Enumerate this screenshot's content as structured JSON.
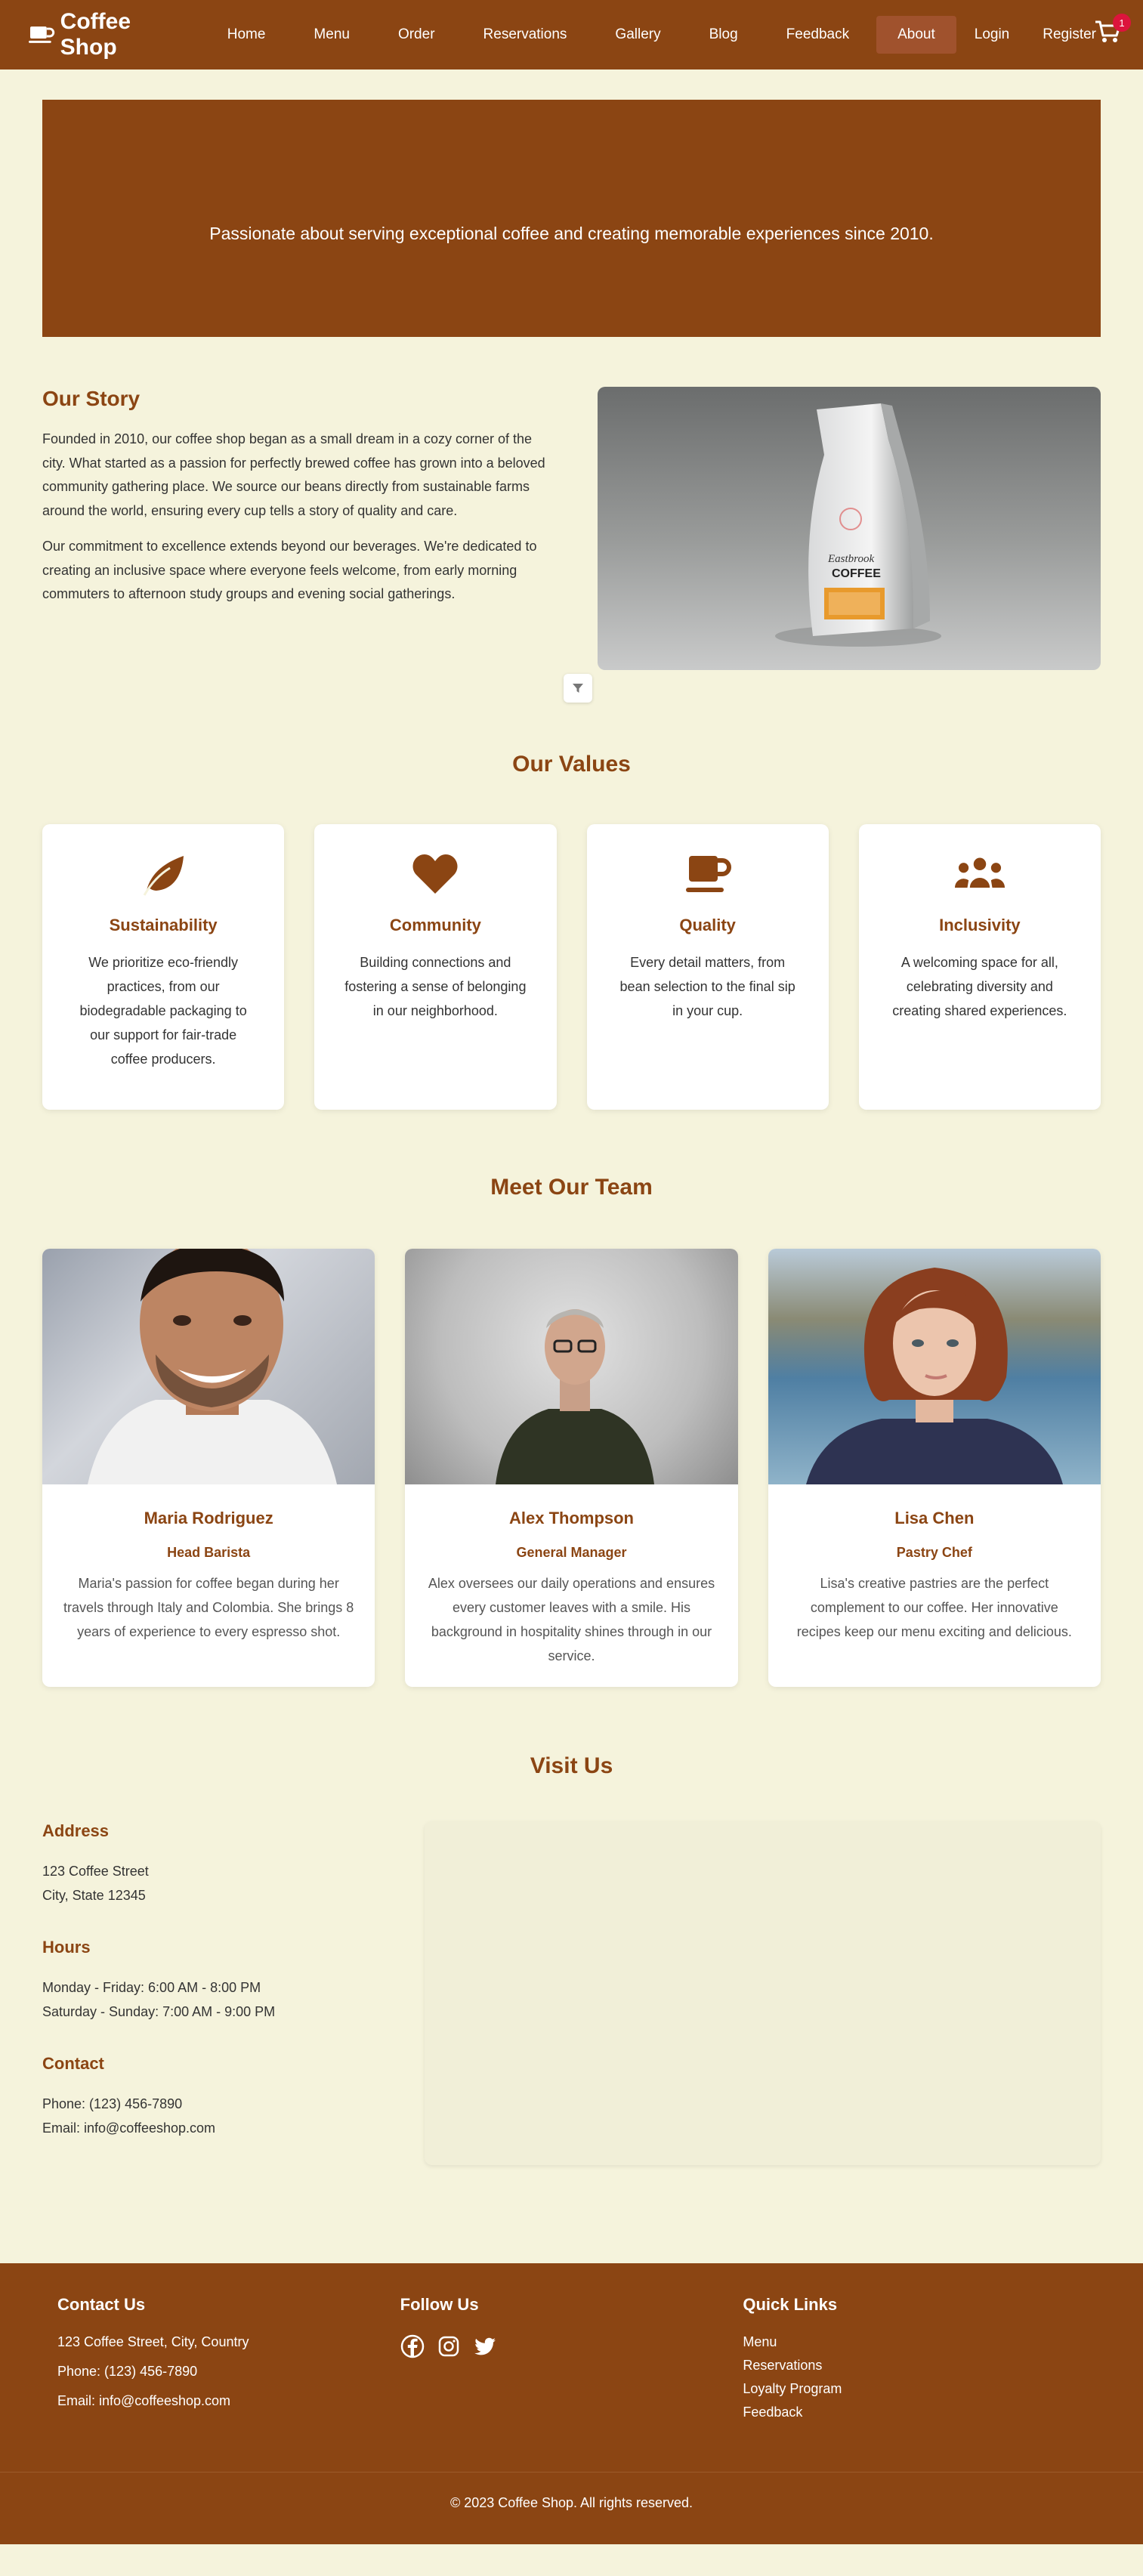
{
  "nav": {
    "brand": "Coffee Shop",
    "items": [
      {
        "label": "Home"
      },
      {
        "label": "Menu"
      },
      {
        "label": "Order"
      },
      {
        "label": "Reservations"
      },
      {
        "label": "Gallery"
      },
      {
        "label": "Blog"
      },
      {
        "label": "Feedback"
      },
      {
        "label": "About",
        "active": true
      }
    ],
    "login": "Login",
    "register": "Register",
    "cart_count": "1"
  },
  "hero": {
    "tagline": "Passionate about serving exceptional coffee and creating memorable experiences since 2010."
  },
  "story": {
    "title": "Our Story",
    "paragraphs": [
      "Founded in 2010, our coffee shop began as a small dream in a cozy corner of the city. What started as a passion for perfectly brewed coffee has grown into a beloved community gathering place. We source our beans directly from sustainable farms around the world, ensuring every cup tells a story of quality and care.",
      "Our commitment to excellence extends beyond our beverages. We're dedicated to creating an inclusive space where everyone feels welcome, from early morning commuters to afternoon study groups and evening social gatherings."
    ],
    "image_bag_text": "COFFEE"
  },
  "values": {
    "title": "Our Values",
    "items": [
      {
        "icon": "leaf-icon",
        "title": "Sustainability",
        "text": "We prioritize eco-friendly practices, from our biodegradable packaging to our support for fair-trade coffee producers."
      },
      {
        "icon": "heart-icon",
        "title": "Community",
        "text": "Building connections and fostering a sense of belonging in our neighborhood."
      },
      {
        "icon": "coffee-cup-icon",
        "title": "Quality",
        "text": "Every detail matters, from bean selection to the final sip in your cup."
      },
      {
        "icon": "users-icon",
        "title": "Inclusivity",
        "text": "A welcoming space for all, celebrating diversity and creating shared experiences."
      }
    ]
  },
  "team": {
    "title": "Meet Our Team",
    "members": [
      {
        "name": "Maria Rodriguez",
        "role": "Head Barista",
        "bio": "Maria's passion for coffee began during her travels through Italy and Colombia. She brings 8 years of experience to every espresso shot."
      },
      {
        "name": "Alex Thompson",
        "role": "General Manager",
        "bio": "Alex oversees our daily operations and ensures every customer leaves with a smile. His background in hospitality shines through in our service."
      },
      {
        "name": "Lisa Chen",
        "role": "Pastry Chef",
        "bio": "Lisa's creative pastries are the perfect complement to our coffee. Her innovative recipes keep our menu exciting and delicious."
      }
    ]
  },
  "visit": {
    "title": "Visit Us",
    "address": {
      "heading": "Address",
      "line1": "123 Coffee Street",
      "line2": "City, State 12345"
    },
    "hours": {
      "heading": "Hours",
      "line1": "Monday - Friday: 6:00 AM - 8:00 PM",
      "line2": "Saturday - Sunday: 7:00 AM - 9:00 PM"
    },
    "contact": {
      "heading": "Contact",
      "line1": "Phone: (123) 456-7890",
      "line2": "Email: info@coffeeshop.com"
    }
  },
  "footer": {
    "contact": {
      "heading": "Contact Us",
      "address": "123 Coffee Street, City, Country",
      "phone": "Phone: (123) 456-7890",
      "email": "Email: info@coffeeshop.com"
    },
    "follow": {
      "heading": "Follow Us",
      "icons": [
        "facebook-icon",
        "instagram-icon",
        "twitter-icon"
      ]
    },
    "links": {
      "heading": "Quick Links",
      "items": [
        "Menu",
        "Reservations",
        "Loyalty Program",
        "Feedback"
      ]
    },
    "copyright": "© 2023 Coffee Shop. All rights reserved."
  },
  "colors": {
    "primary": "#8b4513",
    "active_nav": "#a0522d",
    "background": "#f5f3dc",
    "badge": "#dc143c"
  }
}
